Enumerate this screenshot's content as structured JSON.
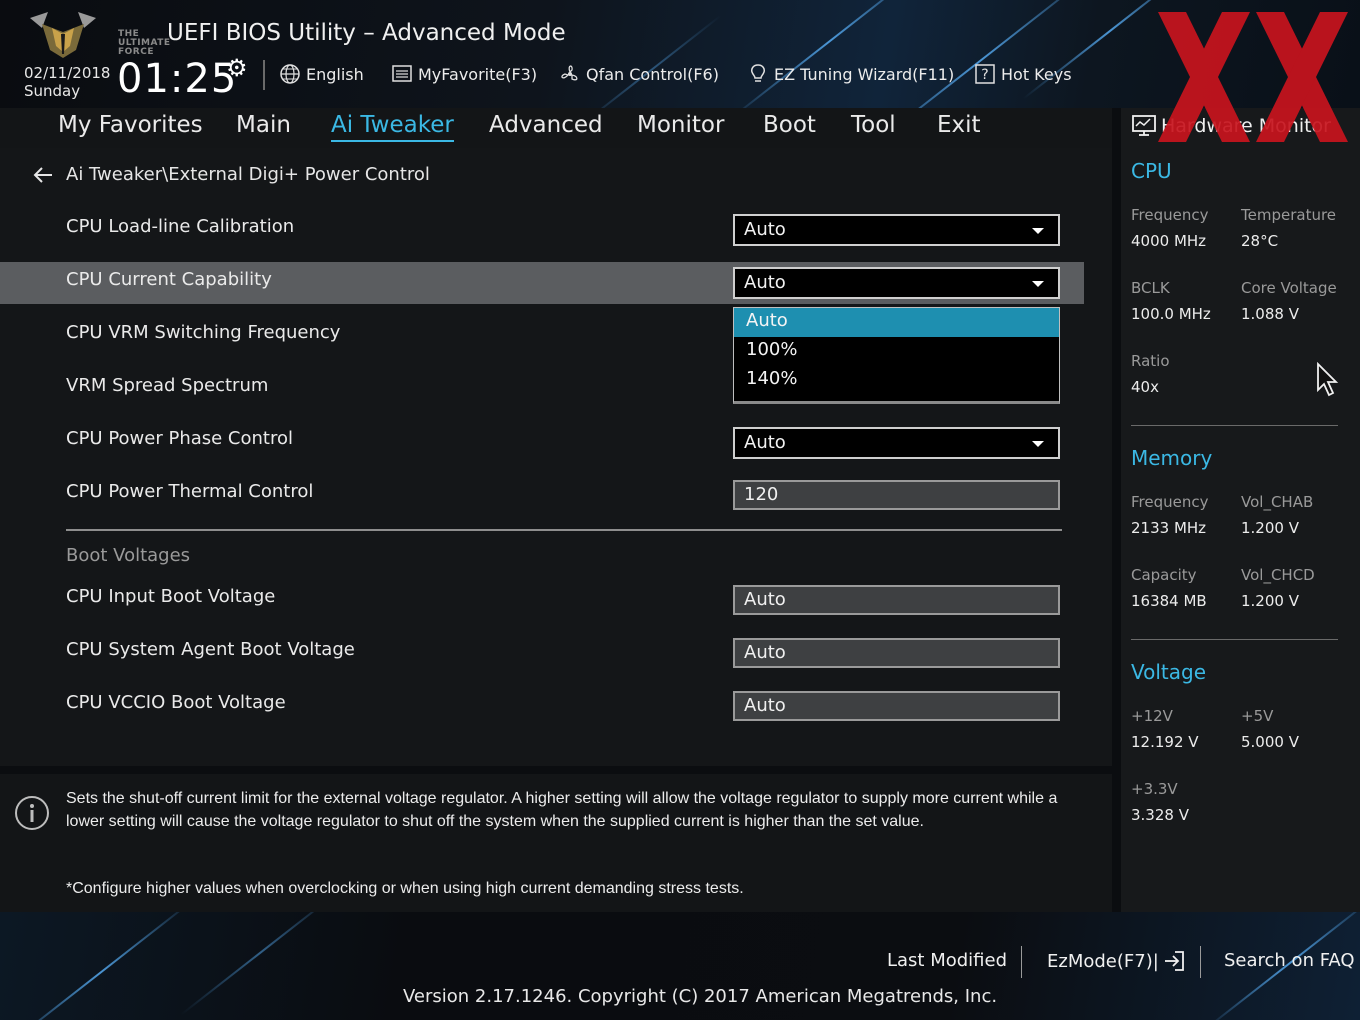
{
  "header": {
    "logo_text": [
      "THE",
      "ULTIMATE",
      "FORCE"
    ],
    "title": "UEFI BIOS Utility – Advanced Mode",
    "date": "02/11/2018",
    "day": "Sunday",
    "time": "01:25",
    "buttons": {
      "language": "English",
      "myfavorite": "MyFavorite(F3)",
      "qfan": "Qfan Control(F6)",
      "ez_tuning": "EZ Tuning Wizard(F11)",
      "hotkeys": "Hot Keys"
    },
    "watermark_color": "#c8141e"
  },
  "menu": {
    "items": [
      "My Favorites",
      "Main",
      "Ai Tweaker",
      "Advanced",
      "Monitor",
      "Boot",
      "Tool",
      "Exit"
    ],
    "active": "Ai Tweaker"
  },
  "breadcrumb": "Ai Tweaker\\External Digi+ Power Control",
  "settings": [
    {
      "label": "CPU Load-line Calibration",
      "value": "Auto"
    },
    {
      "label": "CPU Current Capability",
      "value": "Auto"
    },
    {
      "label": "CPU VRM Switching Frequency",
      "value": ""
    },
    {
      "label": "VRM Spread Spectrum",
      "value": ""
    },
    {
      "label": "CPU Power Phase Control",
      "value": "Auto"
    },
    {
      "label": "CPU Power Thermal Control",
      "value": "120"
    }
  ],
  "dropdown": {
    "options": [
      "Auto",
      "100%",
      "140%"
    ],
    "selected": "Auto"
  },
  "boot_voltages": {
    "section_label": "Boot Voltages",
    "items": [
      {
        "label": "CPU Input Boot Voltage",
        "value": "Auto"
      },
      {
        "label": "CPU System Agent Boot Voltage",
        "value": "Auto"
      },
      {
        "label": "CPU VCCIO Boot Voltage",
        "value": "Auto"
      }
    ]
  },
  "help": {
    "text": "Sets the shut-off current limit for the external voltage regulator. A higher setting will allow the voltage regulator to supply more current while a lower setting will cause the voltage regulator to shut off the system when the supplied current is higher than the set value.",
    "note": "*Configure higher values when overclocking or when using high current demanding stress tests."
  },
  "hardware_monitor": {
    "title": "Hardware Monitor",
    "cpu": {
      "section": "CPU",
      "frequency_label": "Frequency",
      "frequency": "4000 MHz",
      "temperature_label": "Temperature",
      "temperature": "28°C",
      "bclk_label": "BCLK",
      "bclk": "100.0 MHz",
      "core_voltage_label": "Core Voltage",
      "core_voltage": "1.088 V",
      "ratio_label": "Ratio",
      "ratio": "40x"
    },
    "memory": {
      "section": "Memory",
      "frequency_label": "Frequency",
      "frequency": "2133 MHz",
      "vol_chab_label": "Vol_CHAB",
      "vol_chab": "1.200 V",
      "capacity_label": "Capacity",
      "capacity": "16384 MB",
      "vol_chcd_label": "Vol_CHCD",
      "vol_chcd": "1.200 V"
    },
    "voltage": {
      "section": "Voltage",
      "v12_label": "+12V",
      "v12": "12.192 V",
      "v5_label": "+5V",
      "v5": "5.000 V",
      "v33_label": "+3.3V",
      "v33": "3.328 V"
    }
  },
  "footer": {
    "last_modified": "Last Modified",
    "ezmode": "EzMode(F7)|",
    "search_faq": "Search on FAQ",
    "version": "Version 2.17.1246. Copyright (C) 2017 American Megatrends, Inc."
  },
  "colors": {
    "accent": "#3bb8e4",
    "selected_option": "#1e8fb0",
    "highlight_row": "#5b5d60"
  }
}
